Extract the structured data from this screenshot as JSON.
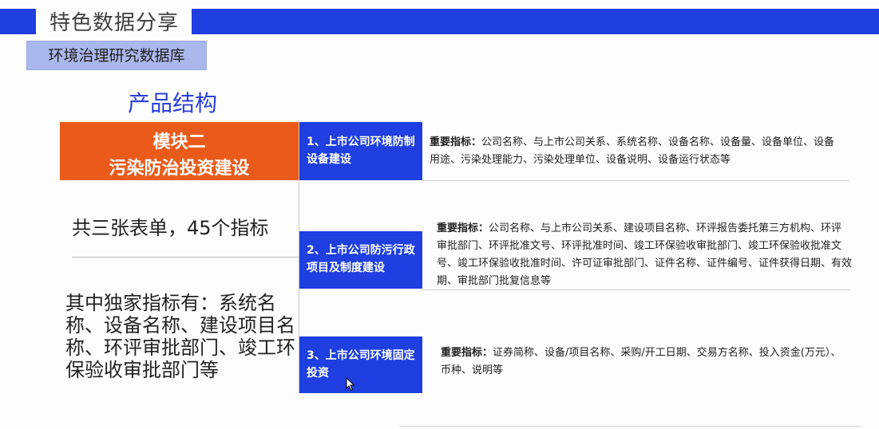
{
  "header": {
    "title": "特色数据分享",
    "subtitle": "环境治理研究数据库",
    "accent_color": "#1f3fe0"
  },
  "section_title": "产品结构",
  "module": {
    "line1": "模块二",
    "line2": "污染防治投资建设",
    "color": "#ea5b1b"
  },
  "summary": "共三张表单，45个指标",
  "exclusive": "其中独家指标有：系统名称、设备名称、建设项目名称、环评审批部门、竣工环保验收审批部门等",
  "tables": [
    {
      "name": "1、上市公司环境防制设备建设",
      "desc_label": "重要指标：",
      "desc": "公司名称、与上市公司关系、系统名称、设备名称、设备量、设备单位、设备用途、污染处理能力、污染处理单位、设备说明、设备运行状态等"
    },
    {
      "name": "2、上市公司防污行政项目及制度建设",
      "desc_label": "重要指标：",
      "desc": "公司名称、与上市公司关系、建设项目名称、环评报告委托第三方机构、环评审批部门、环评批准文号、环评批准时间、竣工环保验收审批部门、竣工环保验收批准文号、竣工环保验收批准时间、许可证审批部门、证件名称、证件编号、证件获得日期、有效期、审批部门批复信息等"
    },
    {
      "name": "3、上市公司环境固定投资",
      "desc_label": "重要指标：",
      "desc": "证券简称、设备/项目名称、采购/开工日期、交易方名称、投入资金(万元）、币种、说明等"
    }
  ]
}
